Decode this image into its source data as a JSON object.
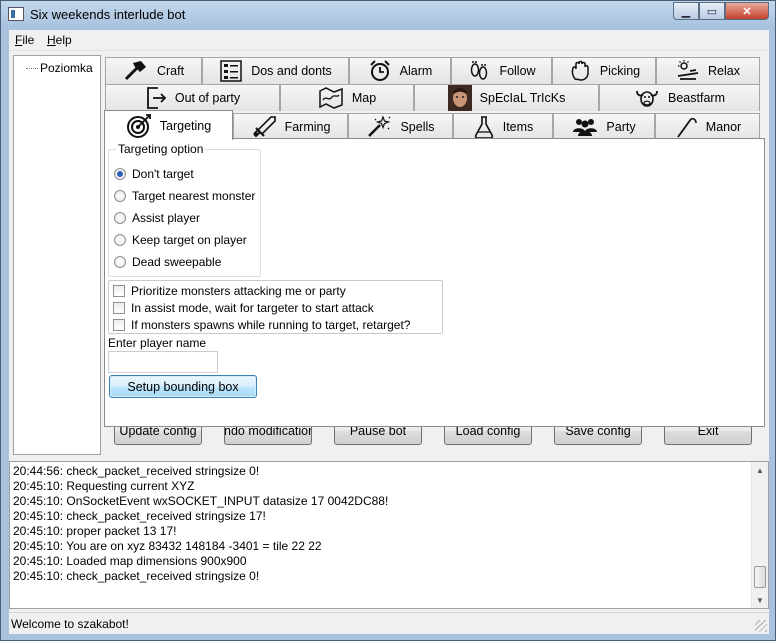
{
  "window": {
    "title": "Six weekends interlude bot"
  },
  "menu": [
    {
      "label": "File",
      "underline": "F",
      "rest": "ile"
    },
    {
      "label": "Help",
      "underline": "H",
      "rest": "elp"
    }
  ],
  "tree": {
    "items": [
      "Poziomka"
    ]
  },
  "tabs": {
    "row1": [
      "Craft",
      "Dos and donts",
      "Alarm",
      "Follow",
      "Picking",
      "Relax"
    ],
    "row2": [
      "Out of party",
      "Map",
      "SpEcIaL TrIcKs",
      "Beastfarm"
    ],
    "row3": [
      "Targeting",
      "Farming",
      "Spells",
      "Items",
      "Party",
      "Manor"
    ],
    "active": "Targeting"
  },
  "targeting": {
    "group_title": "Targeting option",
    "options": [
      "Don't target",
      "Target nearest monster",
      "Assist player",
      "Keep target on player",
      "Dead sweepable"
    ],
    "selected": "Don't target",
    "checkboxes": [
      "Prioritize monsters attacking me or party",
      "In assist mode, wait for targeter to start attack",
      "If monsters spawns while running to target, retarget?"
    ],
    "player_label": "Enter player name",
    "player_value": "",
    "bounding_button": "Setup bounding box"
  },
  "actions": [
    "Update config",
    "Undo modifications",
    "Pause bot",
    "Load config",
    "Save config",
    "Exit"
  ],
  "log": [
    "20:44:56: check_packet_received stringsize 0!",
    "20:45:10: Requesting current XYZ",
    "20:45:10: OnSocketEvent wxSOCKET_INPUT datasize 17 0042DC88!",
    "20:45:10: check_packet_received stringsize 17!",
    "20:45:10: proper packet 13 17!",
    "20:45:10: You are on xyz 83432 148184 -3401 = tile 22 22",
    "20:45:10: Loaded map dimensions 900x900",
    "20:45:10: check_packet_received stringsize 0!"
  ],
  "status": "Welcome to szakabot!"
}
